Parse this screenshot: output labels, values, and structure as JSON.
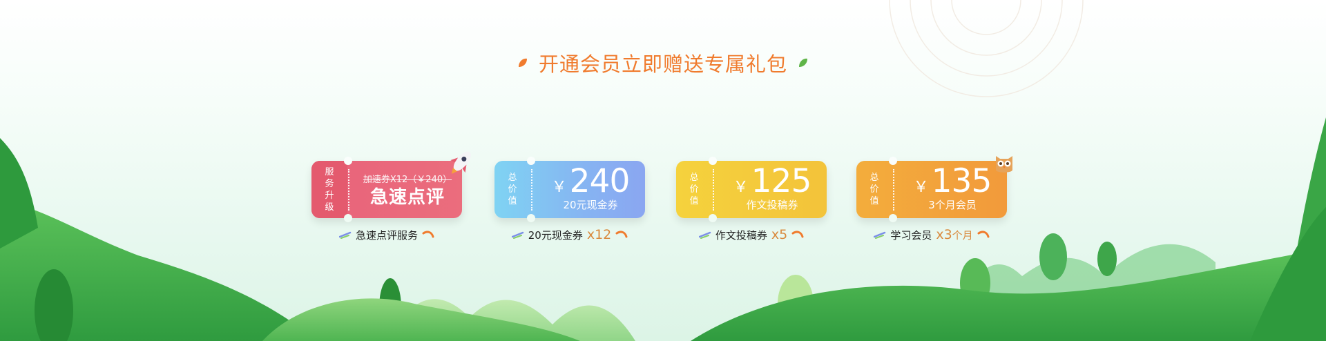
{
  "colors": {
    "title": "#f07b2d",
    "card_red": "#e8637a",
    "card_blue": "#86b4f2",
    "card_yellow": "#f3c83a",
    "card_orange": "#f2a33b",
    "multiplier": "#d98a3e",
    "hill_green": "#3ea64a"
  },
  "header": {
    "title": "开通会员立即赠送专属礼包"
  },
  "cards": [
    {
      "side_label": "服务升级",
      "strike_text": "加速券X12（￥240）",
      "headline": "急速点评",
      "caption_text": "急速点评服务",
      "decor_icon": "rocket-icon"
    },
    {
      "side_label": "总价值",
      "currency": "￥",
      "amount": "240",
      "sub": "20元现金券",
      "caption_text": "20元现金券",
      "caption_mult": "x12"
    },
    {
      "side_label": "总价值",
      "currency": "￥",
      "amount": "125",
      "sub": "作文投稿券",
      "caption_text": "作文投稿券",
      "caption_mult": "x5"
    },
    {
      "side_label": "总价值",
      "currency": "￥",
      "amount": "135",
      "sub": "3个月会员",
      "caption_text": "学习会员",
      "caption_mult": "x3",
      "caption_unit": "个月",
      "decor_icon": "owl-icon"
    }
  ]
}
